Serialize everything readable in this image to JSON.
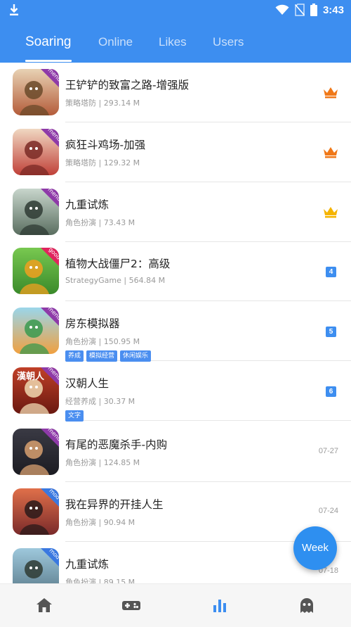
{
  "status_bar": {
    "time": "3:43"
  },
  "tabs": [
    {
      "label": "Soaring",
      "active": true
    },
    {
      "label": "Online"
    },
    {
      "label": "Likes"
    },
    {
      "label": "Users"
    }
  ],
  "apps": [
    {
      "name": "王铲铲的致富之路-增强版",
      "meta": "策略塔防 | 293.14 M",
      "badge": "menu",
      "right": {
        "type": "crown",
        "color": "#f07818"
      }
    },
    {
      "name": "疯狂斗鸡场-加强",
      "meta": "策略塔防 | 129.32 M",
      "badge": "menu",
      "right": {
        "type": "crown",
        "color": "#f07818"
      }
    },
    {
      "name": "九重试炼",
      "meta": "角色扮演 | 73.43 M",
      "badge": "menu",
      "right": {
        "type": "crown",
        "color": "#f5b400"
      }
    },
    {
      "name": "植物大战僵尸2：高级",
      "meta": "StrategyGame | 564.84 M",
      "badge": "good",
      "right": {
        "type": "rank",
        "value": "4"
      }
    },
    {
      "name": "房东模拟器",
      "meta": "角色扮演 | 150.95 M",
      "badge": "menu",
      "tags": [
        "养成",
        "模拟经营",
        "休闲娱乐"
      ],
      "right": {
        "type": "rank",
        "value": "5"
      }
    },
    {
      "name": "汉朝人生",
      "meta": "经营养成 | 30.37 M",
      "badge": "menu",
      "icon_text": "漢朝人",
      "tags": [
        "文字"
      ],
      "right": {
        "type": "rank",
        "value": "6"
      }
    },
    {
      "name": "有尾的恶魔杀手-内购",
      "meta": "角色扮演 | 124.85 M",
      "badge": "menu",
      "right": {
        "type": "date",
        "value": "07-27"
      }
    },
    {
      "name": "我在异界的开挂人生",
      "meta": "角色扮演 | 90.94 M",
      "badge": "mod",
      "right": {
        "type": "date",
        "value": "07-24"
      }
    },
    {
      "name": "九重试炼",
      "meta": "角色扮演 | 89.15 M",
      "badge": "mod",
      "right": {
        "type": "date",
        "value": "07-18"
      }
    }
  ],
  "fab": {
    "label": "Week"
  },
  "bottom_nav": [
    {
      "icon": "home-icon",
      "active": false
    },
    {
      "icon": "gamepad-icon",
      "active": false
    },
    {
      "icon": "chart-icon",
      "active": true
    },
    {
      "icon": "ghost-icon",
      "active": false
    }
  ],
  "colors": {
    "header": "#3d8ef0",
    "accent": "#2e8ff0",
    "tag": "#4a8ef0"
  }
}
